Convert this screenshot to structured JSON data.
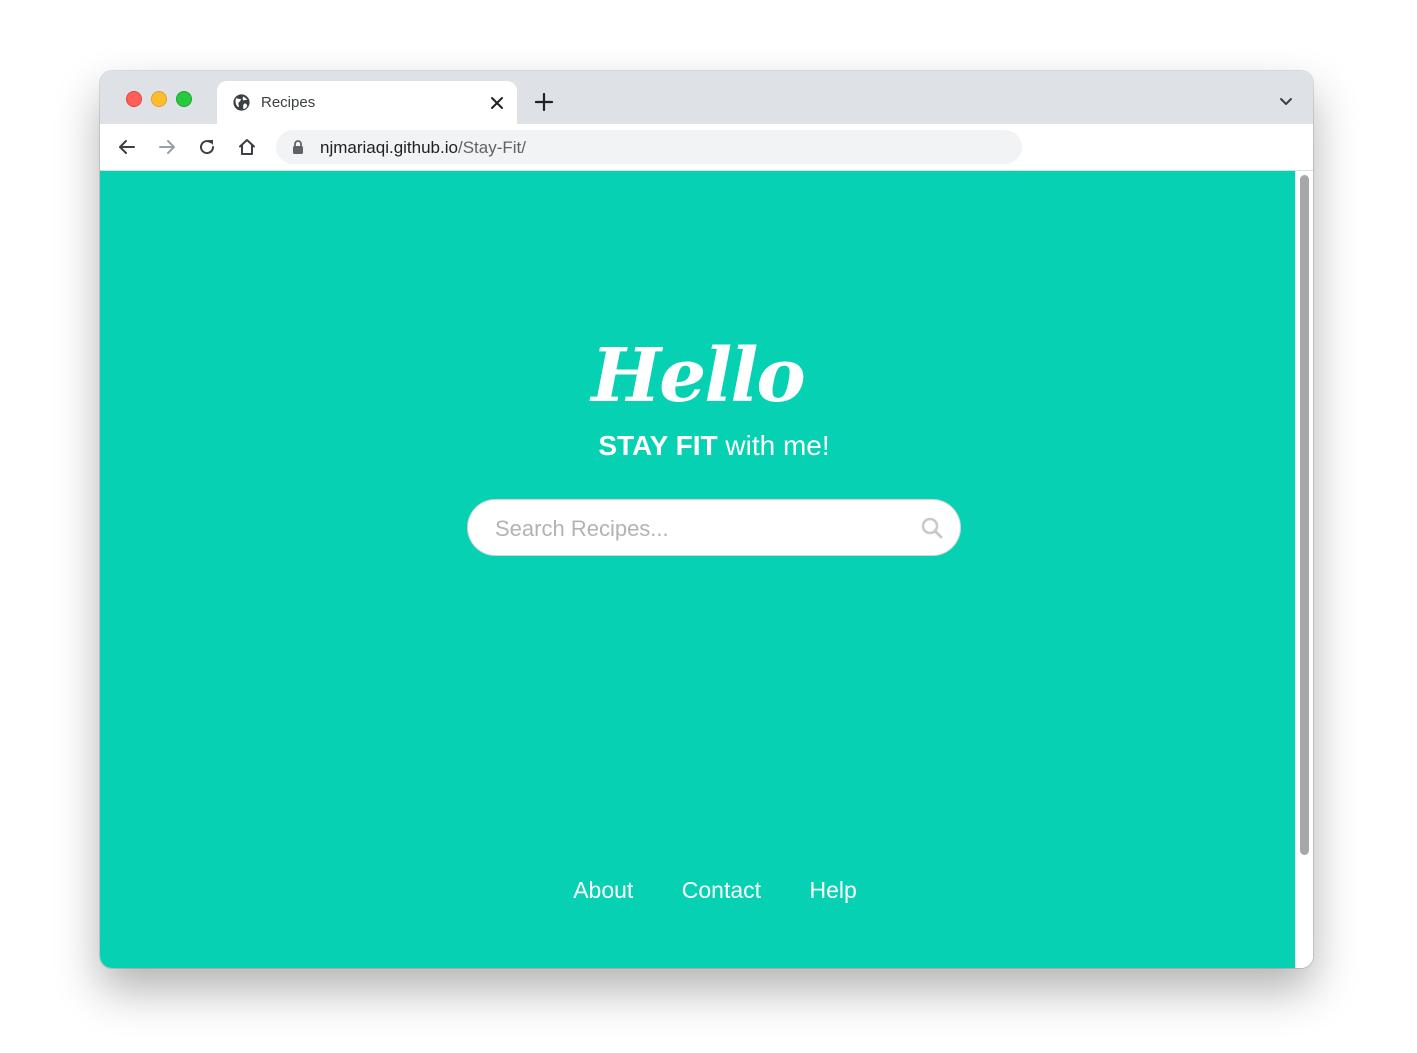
{
  "browser": {
    "tab_title": "Recipes",
    "url_host": "njmariaqi.github.io",
    "url_path": "/Stay-Fit/"
  },
  "page": {
    "background_color": "#06d2b3",
    "hello": "Hello",
    "tagline_bold": "STAY FIT",
    "tagline_rest": " with me!",
    "search_placeholder": "Search Recipes...",
    "footer_links": [
      "About",
      "Contact",
      "Help"
    ]
  },
  "icons": {
    "tab": "globe-icon",
    "tab_close": "close-icon",
    "new_tab": "plus-icon",
    "tab_menu": "chevron-down-icon",
    "back": "arrow-left-icon",
    "forward": "arrow-right-icon",
    "reload": "reload-icon",
    "home": "home-icon",
    "secure": "lock-icon",
    "search": "search-icon"
  }
}
